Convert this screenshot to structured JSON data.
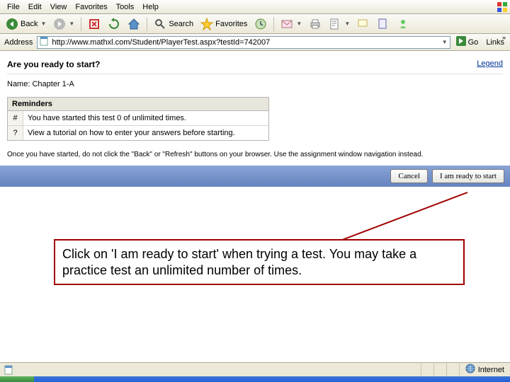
{
  "menubar": [
    "File",
    "Edit",
    "View",
    "Favorites",
    "Tools",
    "Help"
  ],
  "toolbar": {
    "back": "Back",
    "search": "Search",
    "favorites": "Favorites"
  },
  "address": {
    "label": "Address",
    "url": "http://www.mathxl.com/Student/PlayerTest.aspx?testId=742007",
    "go": "Go",
    "links": "Links"
  },
  "page": {
    "title": "Are you ready to start?",
    "legend": "Legend",
    "name_label": "Name:",
    "name_value": "Chapter 1-A",
    "reminders_header": "Reminders",
    "reminders": [
      {
        "icon": "#",
        "text": "You have started this test 0 of unlimited times."
      },
      {
        "icon": "?",
        "text": "View a tutorial on how to enter your answers before starting."
      }
    ],
    "note": "Once you have started, do not click the \"Back\" or \"Refresh\" buttons on your browser. Use the assignment window navigation instead.",
    "cancel": "Cancel",
    "ready": "I am ready to start"
  },
  "callout": "Click on 'I am ready to start' when trying a test.  You may take a practice test an unlimited number of times.",
  "status": {
    "zone": "Internet"
  }
}
